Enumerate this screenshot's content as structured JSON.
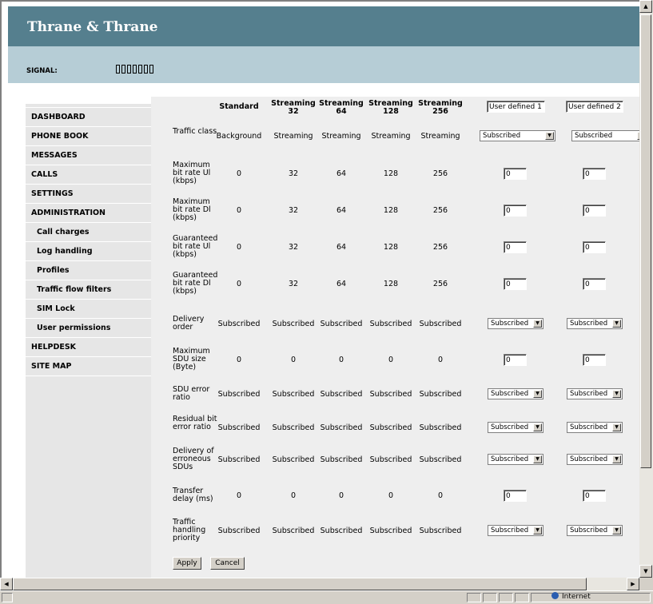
{
  "brand": "Thrane & Thrane",
  "signal": {
    "label": "SIGNAL:",
    "bars": 7
  },
  "nav": [
    {
      "label": "DASHBOARD",
      "sub": false
    },
    {
      "label": "PHONE BOOK",
      "sub": false
    },
    {
      "label": "MESSAGES",
      "sub": false
    },
    {
      "label": "CALLS",
      "sub": false
    },
    {
      "label": "SETTINGS",
      "sub": false
    },
    {
      "label": "ADMINISTRATION",
      "sub": false
    },
    {
      "label": "Call charges",
      "sub": true
    },
    {
      "label": "Log handling",
      "sub": true
    },
    {
      "label": "Profiles",
      "sub": true
    },
    {
      "label": "Traffic flow filters",
      "sub": true
    },
    {
      "label": "SIM Lock",
      "sub": true
    },
    {
      "label": "User permissions",
      "sub": true
    },
    {
      "label": "HELPDESK",
      "sub": false
    },
    {
      "label": "SITE MAP",
      "sub": false
    }
  ],
  "table": {
    "columns": [
      {
        "line1": "Standard",
        "line2": ""
      },
      {
        "line1": "Streaming",
        "line2": "32"
      },
      {
        "line1": "Streaming",
        "line2": "64"
      },
      {
        "line1": "Streaming",
        "line2": "128"
      },
      {
        "line1": "Streaming",
        "line2": "256"
      }
    ],
    "user_columns": [
      "User defined 1",
      "User defined 2"
    ],
    "rows": [
      {
        "label": "Traffic class",
        "values": [
          "Background",
          "Streaming",
          "Streaming",
          "Streaming",
          "Streaming"
        ],
        "input": "select",
        "user_values": [
          "Subscribed",
          "Subscribed"
        ]
      },
      {
        "label": "Maximum bit rate Ul (kbps)",
        "values": [
          "0",
          "32",
          "64",
          "128",
          "256"
        ],
        "input": "text",
        "user_values": [
          "0",
          "0"
        ]
      },
      {
        "label": "Maximum bit rate Dl (kbps)",
        "values": [
          "0",
          "32",
          "64",
          "128",
          "256"
        ],
        "input": "text",
        "user_values": [
          "0",
          "0"
        ]
      },
      {
        "label": "Guaranteed bit rate Ul (kbps)",
        "values": [
          "0",
          "32",
          "64",
          "128",
          "256"
        ],
        "input": "text",
        "user_values": [
          "0",
          "0"
        ]
      },
      {
        "label": "Guaranteed bit rate Dl (kbps)",
        "values": [
          "0",
          "32",
          "64",
          "128",
          "256"
        ],
        "input": "text",
        "user_values": [
          "0",
          "0"
        ]
      },
      {
        "label": "Delivery order",
        "values": [
          "Subscribed",
          "Subscribed",
          "Subscribed",
          "Subscribed",
          "Subscribed"
        ],
        "input": "smallselect",
        "user_values": [
          "Subscribed",
          "Subscribed"
        ]
      },
      {
        "label": "Maximum SDU size (Byte)",
        "values": [
          "0",
          "0",
          "0",
          "0",
          "0"
        ],
        "input": "text",
        "user_values": [
          "0",
          "0"
        ]
      },
      {
        "label": "SDU error ratio",
        "values": [
          "Subscribed",
          "Subscribed",
          "Subscribed",
          "Subscribed",
          "Subscribed"
        ],
        "input": "smallselect",
        "user_values": [
          "Subscribed",
          "Subscribed"
        ]
      },
      {
        "label": "Residual bit error ratio",
        "values": [
          "Subscribed",
          "Subscribed",
          "Subscribed",
          "Subscribed",
          "Subscribed"
        ],
        "input": "smallselect",
        "user_values": [
          "Subscribed",
          "Subscribed"
        ]
      },
      {
        "label": "Delivery of erroneous SDUs",
        "values": [
          "Subscribed",
          "Subscribed",
          "Subscribed",
          "Subscribed",
          "Subscribed"
        ],
        "input": "smallselect",
        "user_values": [
          "Subscribed",
          "Subscribed"
        ]
      },
      {
        "label": "Transfer delay (ms)",
        "values": [
          "0",
          "0",
          "0",
          "0",
          "0"
        ],
        "input": "text",
        "user_values": [
          "0",
          "0"
        ]
      },
      {
        "label": "Traffic handling priority",
        "values": [
          "Subscribed",
          "Subscribed",
          "Subscribed",
          "Subscribed",
          "Subscribed"
        ],
        "input": "smallselect",
        "user_values": [
          "Subscribed",
          "Subscribed"
        ]
      }
    ]
  },
  "buttons": {
    "apply": "Apply",
    "cancel": "Cancel"
  },
  "statusbar": {
    "zone": "Internet"
  }
}
